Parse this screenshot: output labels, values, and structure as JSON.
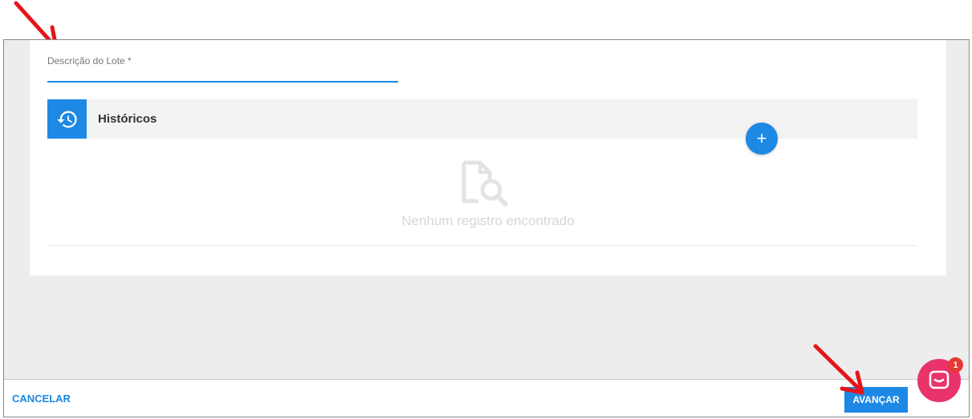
{
  "form": {
    "description_label": "Descrição do Lote *",
    "description_value": ""
  },
  "history": {
    "title": "Históricos",
    "add_symbol": "+",
    "empty_message": "Nenhum registro encontrado"
  },
  "footer": {
    "cancel_label": "CANCELAR",
    "next_label": "AVANÇAR"
  },
  "chat": {
    "badge_count": "1"
  },
  "colors": {
    "accent": "#1e88e5",
    "chat": "#e8336b",
    "annotation": "#e5141b"
  },
  "icons": {
    "history": "history-icon",
    "empty": "file-search-icon",
    "chat": "chat-bubble-icon",
    "annotation": "red-arrow"
  }
}
